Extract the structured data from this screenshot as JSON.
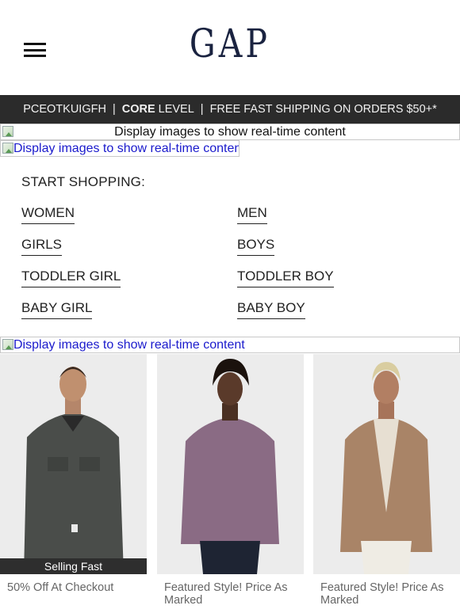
{
  "header": {
    "logo_text": "GAP",
    "menu_icon": "hamburger-menu-icon"
  },
  "banner": {
    "code": "PCEOTKUIGFH",
    "separator": "|",
    "level_bold": "CORE",
    "level_rest": " LEVEL",
    "shipping": "FREE FAST SHIPPING ON ORDERS $50+*"
  },
  "image_placeholders": {
    "top": "Display images to show real-time content",
    "link1": "Display images to show real-time content",
    "link2": "Display images to show real-time content",
    "icon": "broken-image-icon"
  },
  "shopping": {
    "heading": "START SHOPPING:",
    "links": [
      "WOMEN",
      "MEN",
      "GIRLS",
      "BOYS",
      "TODDLER GIRL",
      "TODDLER BOY",
      "BABY GIRL",
      "BABY BOY"
    ]
  },
  "products": [
    {
      "badge": "Selling Fast",
      "caption": "50% Off At Checkout",
      "color": "#4a4d4a"
    },
    {
      "badge": "",
      "caption": "Featured Style! Price As Marked",
      "color": "#8a6b84"
    },
    {
      "badge": "",
      "caption": "Featured Style! Price As Marked",
      "color": "#a98467"
    }
  ],
  "colors": {
    "banner_bg": "#2b2b2b",
    "link_blue": "#1a1acc",
    "logo_navy": "#1a2340"
  }
}
